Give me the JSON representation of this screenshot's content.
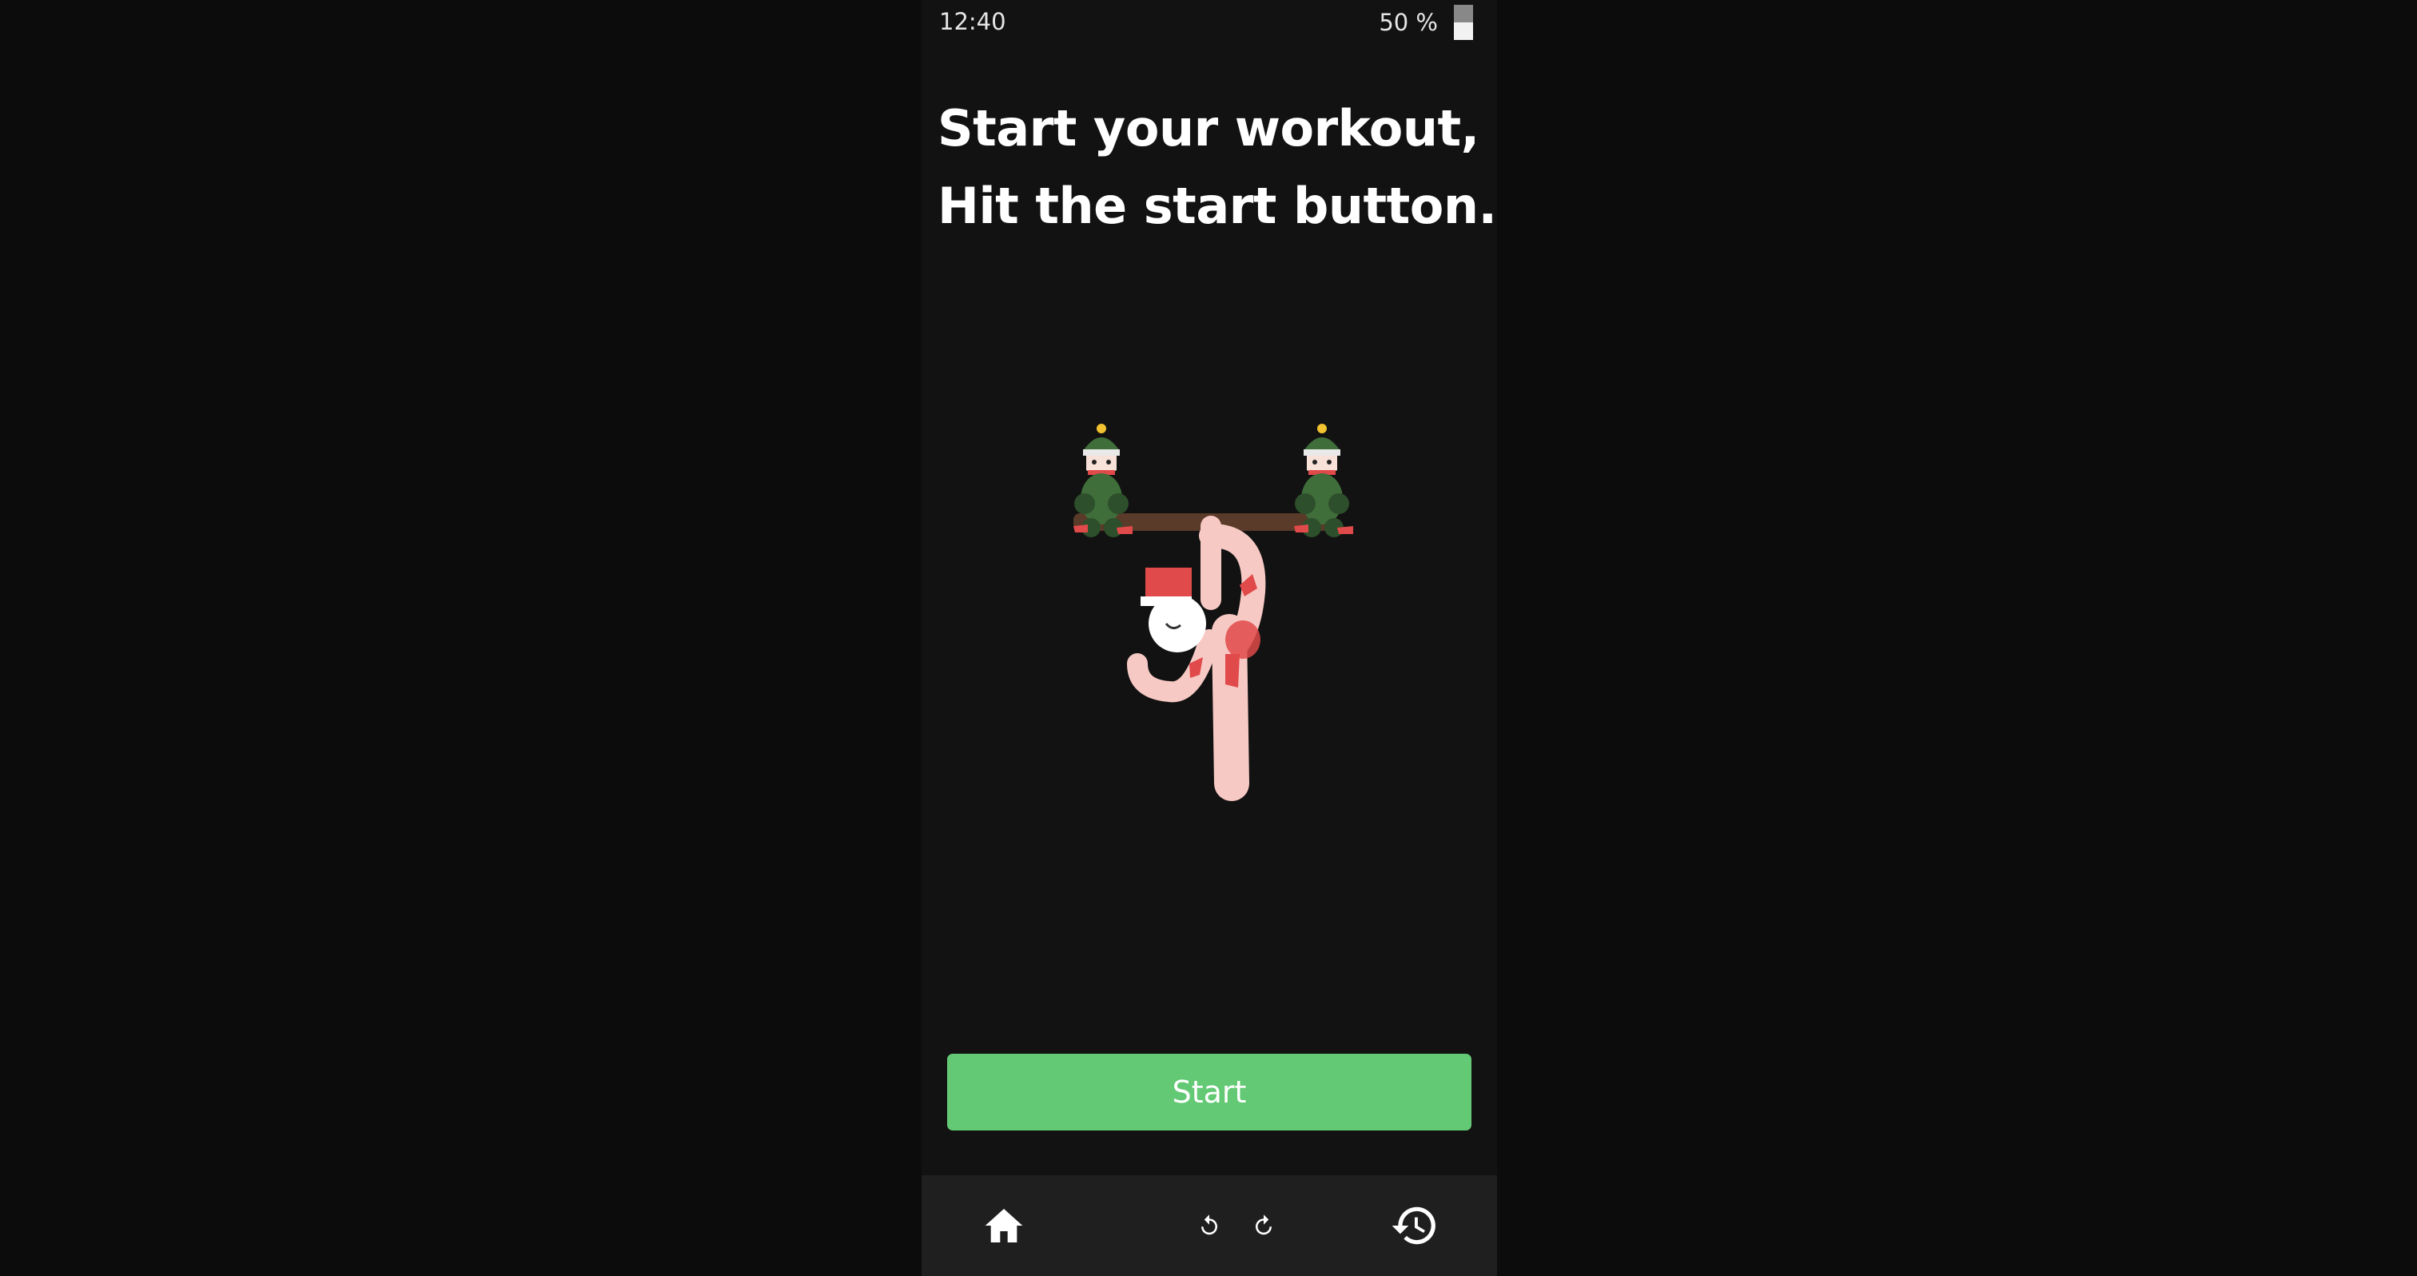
{
  "status_bar": {
    "time": "12:40",
    "battery": "50 %",
    "battery_level": 0.5
  },
  "headline": {
    "line1": "Start your workout,",
    "line2": "Hit the start button."
  },
  "illustration": {
    "icon": "santa-hanging-from-bar-with-elves",
    "colors": {
      "bar": "#5a3a28",
      "elf_green": "#3f6e3a",
      "elf_dark": "#2d4f2b",
      "santa_red": "#e14a4a",
      "skin": "#f7c9c4"
    }
  },
  "start_button": {
    "label": "Start",
    "color": "#63c975"
  },
  "bottom_nav": {
    "home_icon": "home-icon",
    "undo_icon": "undo-icon",
    "redo_icon": "redo-icon",
    "history_icon": "history-icon"
  }
}
